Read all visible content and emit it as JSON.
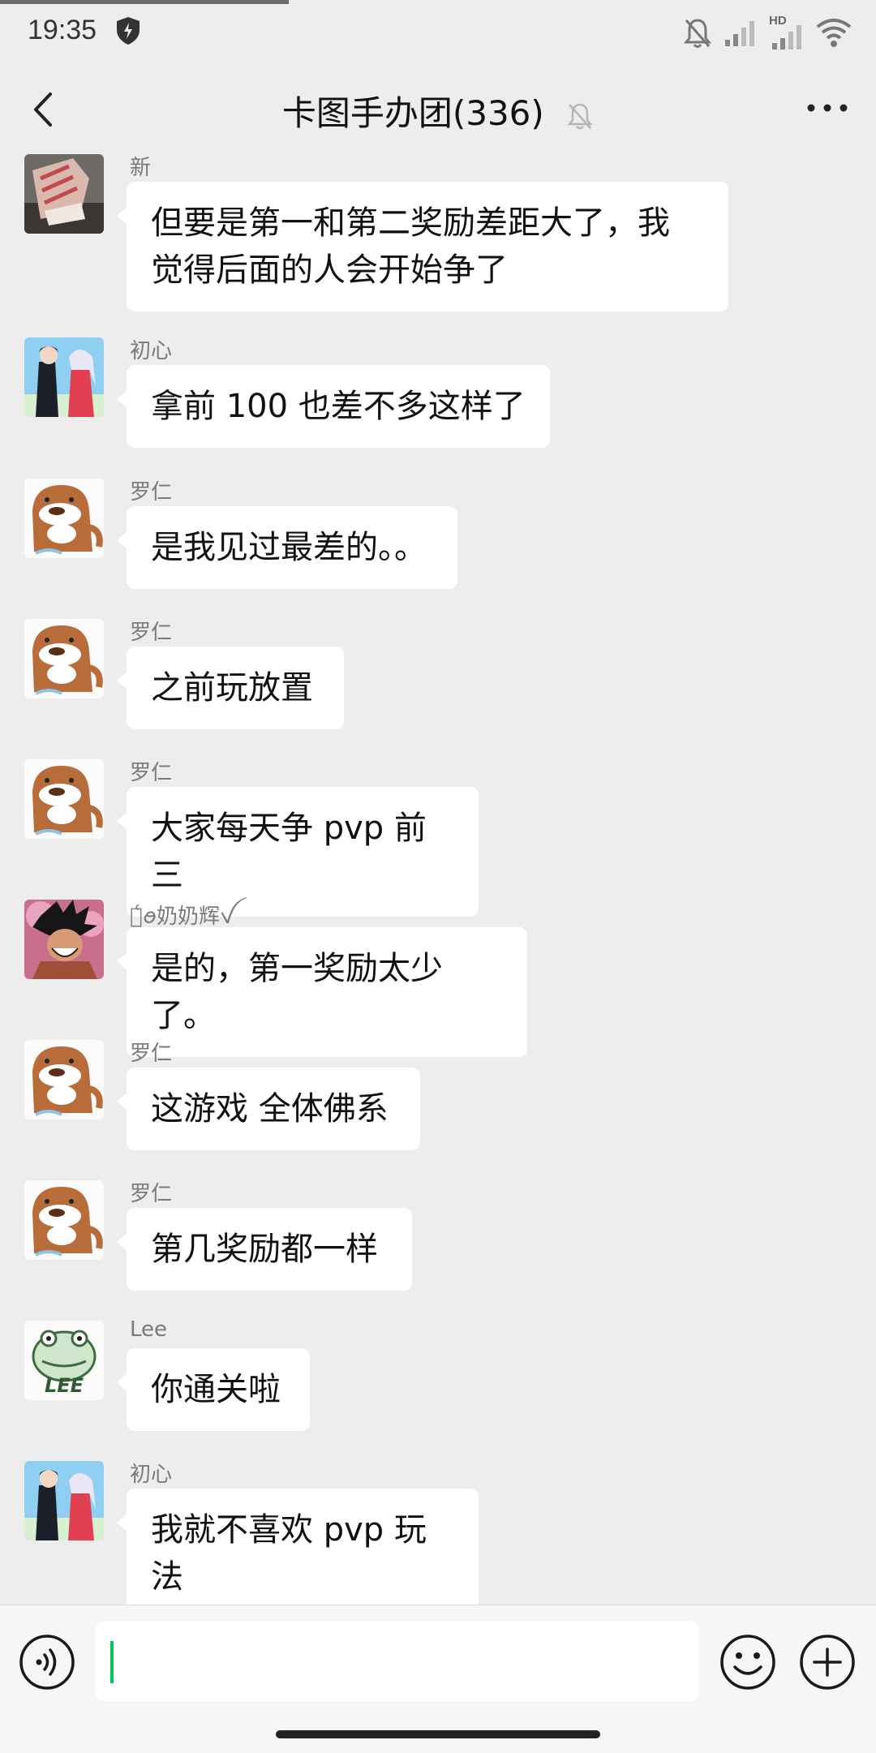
{
  "status_bar": {
    "time": "19:35",
    "network_badge": "HD",
    "icons": [
      "shield-icon",
      "bell-off-icon",
      "signal-icon",
      "signal-hd-icon",
      "wifi-icon"
    ]
  },
  "header": {
    "title": "卡图手办团(336)",
    "back_icon": "chevron-left-icon",
    "mute_icon": "bell-off-icon",
    "more_icon": "more-dots-icon"
  },
  "messages": [
    {
      "sender": "新",
      "lines": [
        "但要是第一和第二奖励差距大了，我",
        "觉得后面的人会开始争了"
      ],
      "avatar": "sneaker"
    },
    {
      "sender": "初心",
      "lines": [
        "拿前 100 也差不多这样了"
      ],
      "avatar": "anime-couple"
    },
    {
      "sender": "罗仁",
      "lines": [
        "是我见过最差的。。"
      ],
      "avatar": "otter"
    },
    {
      "sender": "罗仁",
      "lines": [
        "之前玩放置"
      ],
      "avatar": "otter"
    },
    {
      "sender": "罗仁",
      "lines": [
        "大家每天争 pvp 前三"
      ],
      "avatar": "otter"
    },
    {
      "sender": "ꪮ͑ꪮ奶奶辉ꪜ",
      "lines": [
        "是的，第一奖励太少了。"
      ],
      "avatar": "anime-fighter"
    },
    {
      "sender": "罗仁",
      "lines": [
        "这游戏 全体佛系"
      ],
      "avatar": "otter"
    },
    {
      "sender": "罗仁",
      "lines": [
        "第几奖励都一样"
      ],
      "avatar": "otter"
    },
    {
      "sender": "Lee",
      "lines": [
        "你通关啦"
      ],
      "avatar": "lee-frog"
    },
    {
      "sender": "初心",
      "lines": [
        "我就不喜欢 pvp 玩法"
      ],
      "avatar": "anime-couple"
    }
  ],
  "input_bar": {
    "text_value": "",
    "voice_icon": "voice-icon",
    "emoji_icon": "emoji-icon",
    "plus_icon": "plus-icon"
  },
  "colors": {
    "background": "#ededed",
    "bubble": "#ffffff",
    "cursor": "#07c160"
  }
}
